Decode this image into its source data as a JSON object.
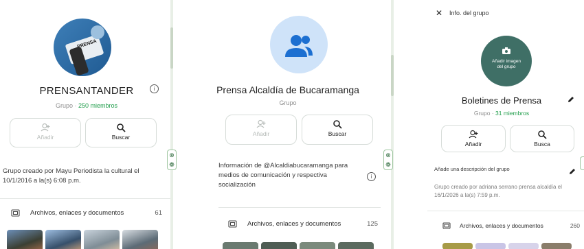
{
  "panel1": {
    "group_name": "PRENSANTANDER",
    "group_label": "Grupo",
    "members": "250 miembros",
    "avatar_text": "PRENSA",
    "actions": [
      {
        "label": "Añadir"
      },
      {
        "label": "Buscar"
      }
    ],
    "description": "Grupo creado por Mayu Periodista la cultural el 10/1/2016 a la(s) 6:08 p.m.",
    "files_label": "Archivos, enlaces y documentos",
    "files_count": "61"
  },
  "panel2": {
    "group_name": "Prensa Alcaldía de Bucaramanga",
    "group_label": "Grupo",
    "actions": [
      {
        "label": "Añadir"
      },
      {
        "label": "Buscar"
      }
    ],
    "description": "Información de @Alcaldiabucaramanga para medios de comunicación y respectiva socialización",
    "files_label": "Archivos, enlaces y documentos",
    "files_count": "125"
  },
  "panel3": {
    "header_title": "Info. del grupo",
    "avatar_text": "Añadir imagen del grupo",
    "group_name": "Boletines de Prensa",
    "group_label": "Grupo",
    "members": "31 miembros",
    "actions": [
      {
        "label": "Añadir"
      },
      {
        "label": "Busca"
      }
    ],
    "add_description": "Añade una descripción del grupo",
    "description": "Grupo creado por adriana serrano prensa alcaldía el 16/1/2026 a la(s) 7:59 p.m.",
    "files_label": "Archivos, enlaces y documentos",
    "files_count": "260"
  },
  "colors": {
    "accent_green": "#1f9d4a",
    "avatar_blue_bg": "#cfe3f9",
    "avatar_blue_icon": "#1c6fd1",
    "avatar_teal": "#3f6f66"
  }
}
